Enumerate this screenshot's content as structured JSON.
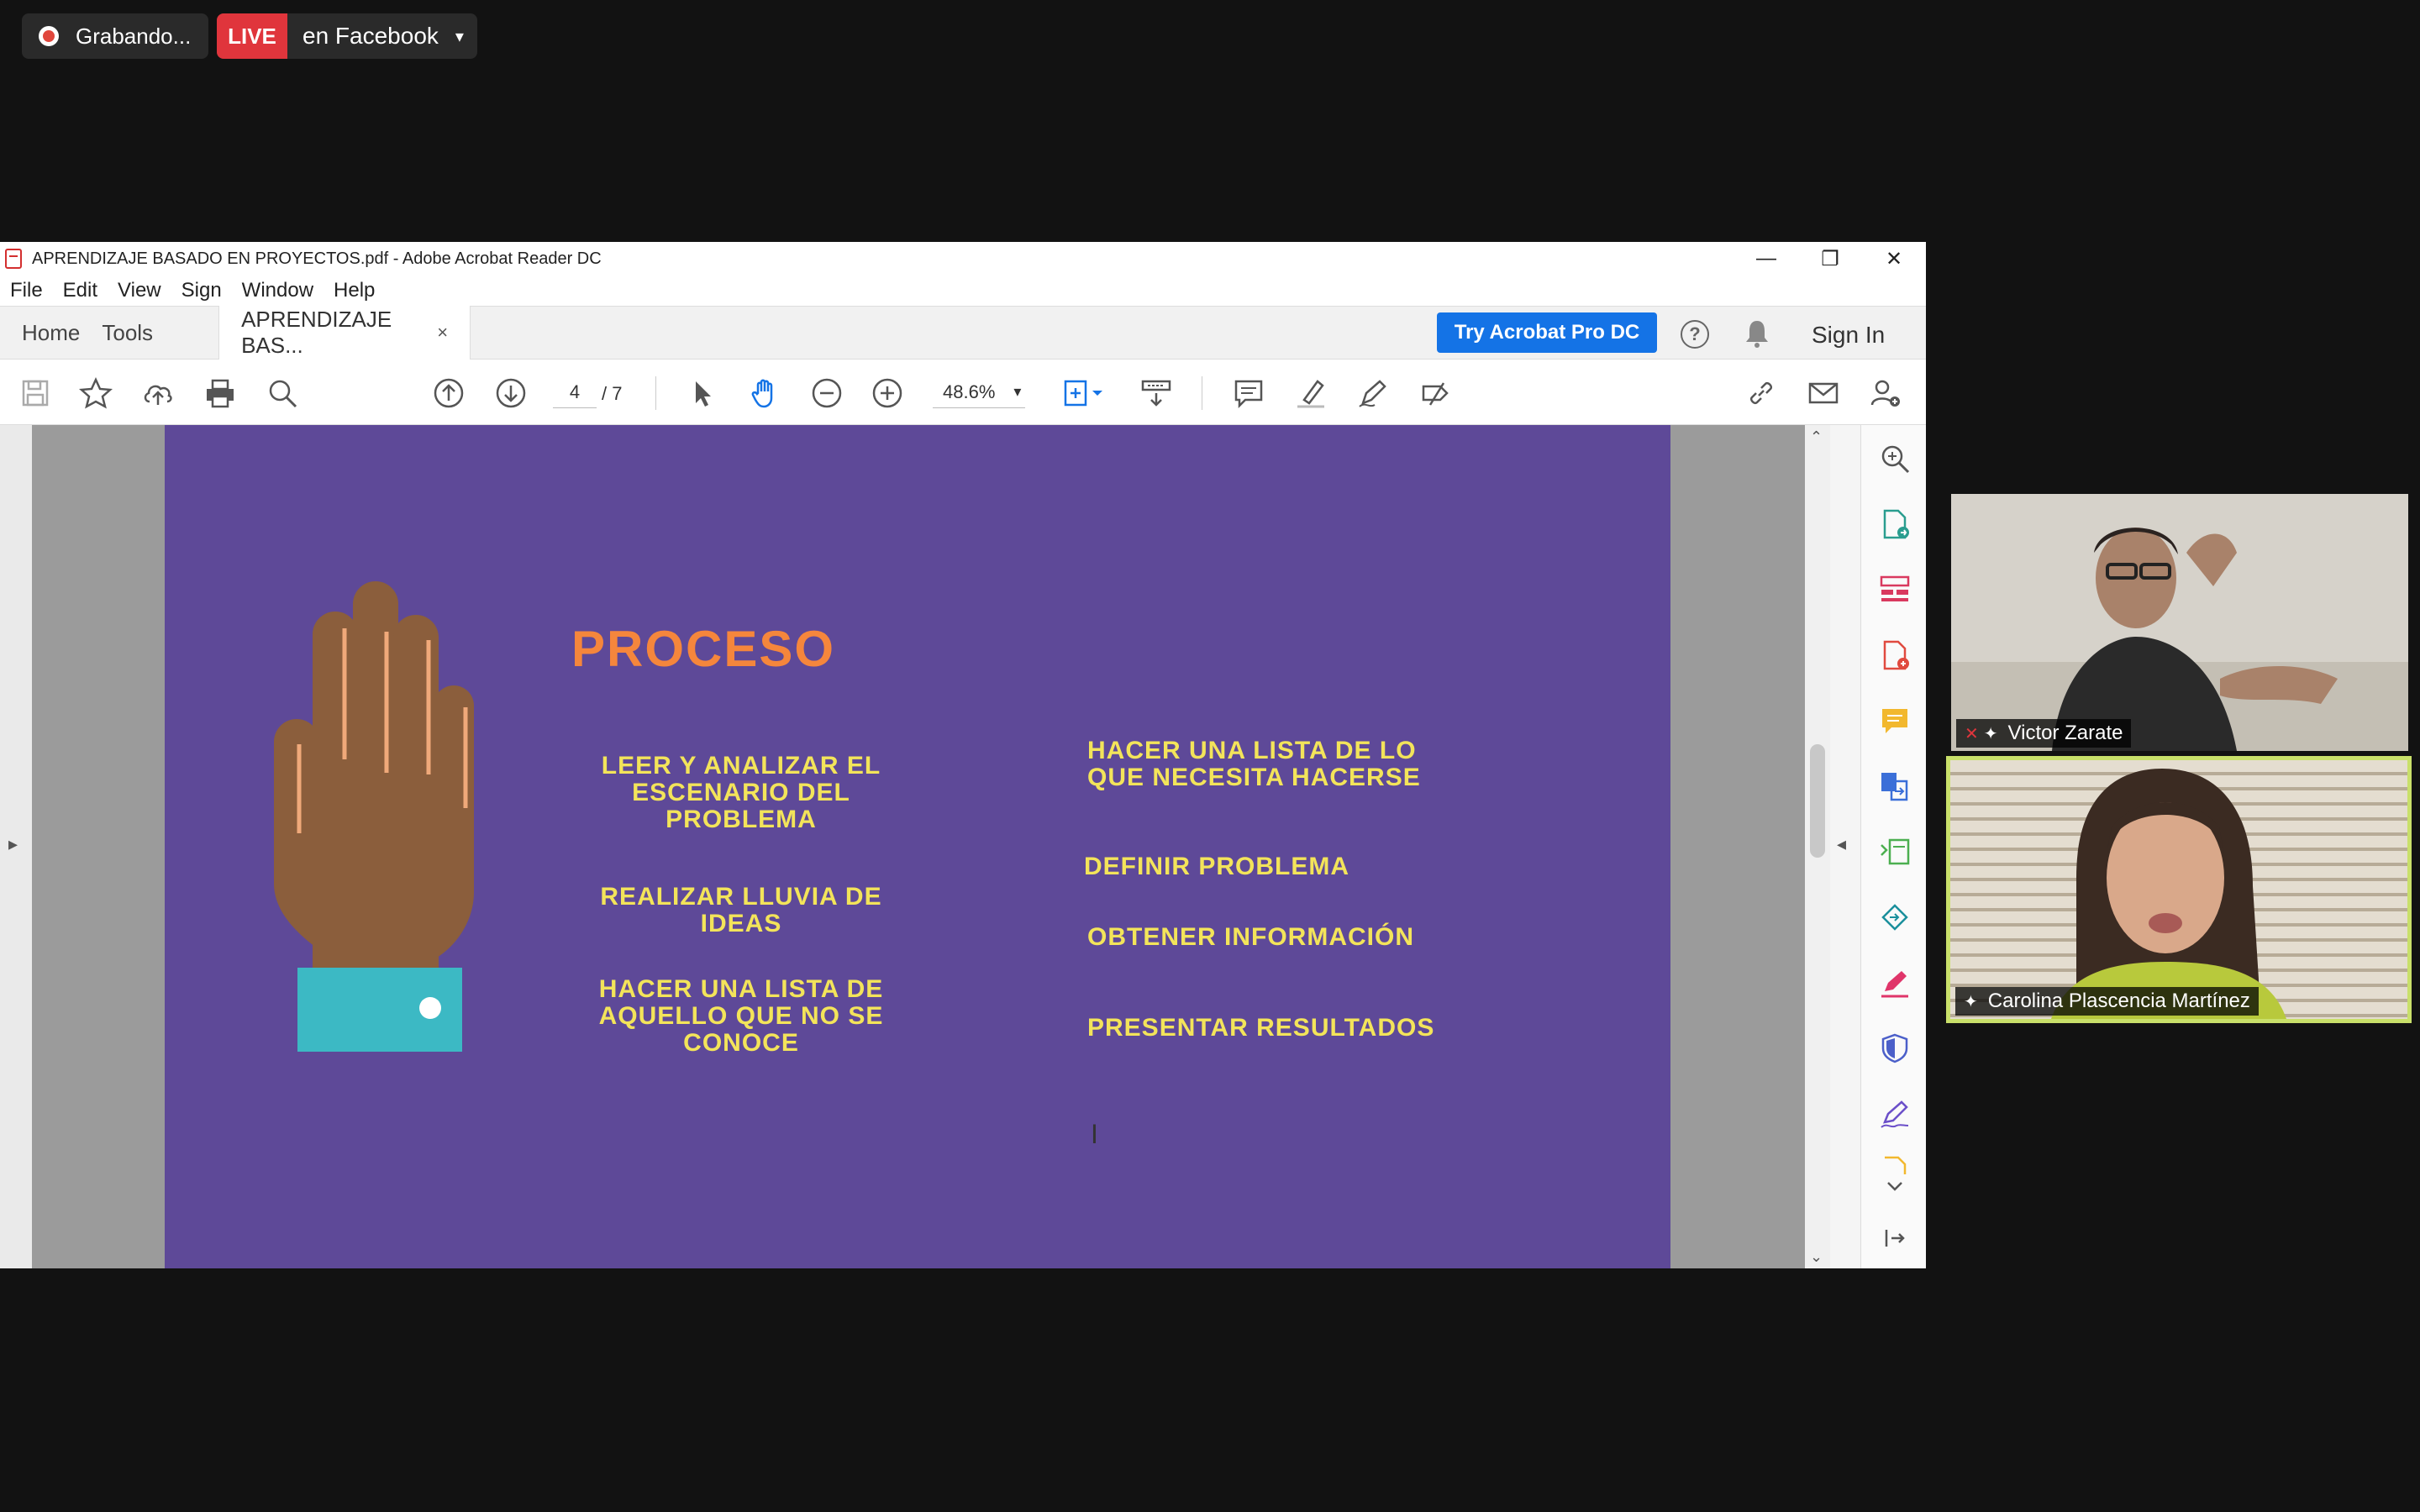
{
  "zoom": {
    "recording_label": "Grabando...",
    "live_badge": "LIVE",
    "live_target": "en Facebook",
    "live_caret": "▾"
  },
  "acrobat": {
    "title": "APRENDIZAJE BASADO EN PROYECTOS.pdf - Adobe Acrobat Reader DC",
    "window_controls": {
      "minimize": "—",
      "restore": "❐",
      "close": "✕"
    },
    "menu": [
      "File",
      "Edit",
      "View",
      "Sign",
      "Window",
      "Help"
    ],
    "tabs": {
      "home": "Home",
      "tools": "Tools",
      "document": "APRENDIZAJE BAS...",
      "close": "×"
    },
    "try_button": "Try Acrobat Pro DC",
    "help": "?",
    "sign_in": "Sign In",
    "toolbar": {
      "page_current": "4",
      "page_total": "/ 7",
      "zoom": "48.6%",
      "zoom_caret": "▾"
    },
    "left_collapse": "▸",
    "right_collapse": "◂",
    "scroll_up": "⌃",
    "scroll_down": "⌄"
  },
  "slide": {
    "heading": "PROCESO",
    "left_steps": [
      "LEER Y ANALIZAR EL ESCENARIO DEL PROBLEMA",
      "REALIZAR LLUVIA DE IDEAS",
      "HACER UNA LISTA DE AQUELLO QUE NO SE CONOCE"
    ],
    "right_steps": [
      "HACER UNA LISTA DE LO QUE NECESITA HACERSE",
      "DEFINIR PROBLEMA",
      "OBTENER INFORMACIÓN",
      "PRESENTAR RESULTADOS"
    ]
  },
  "participants": [
    {
      "name": "Victor Zarate"
    },
    {
      "name": "Carolina Plascencia Martínez"
    }
  ],
  "cursor": "I"
}
